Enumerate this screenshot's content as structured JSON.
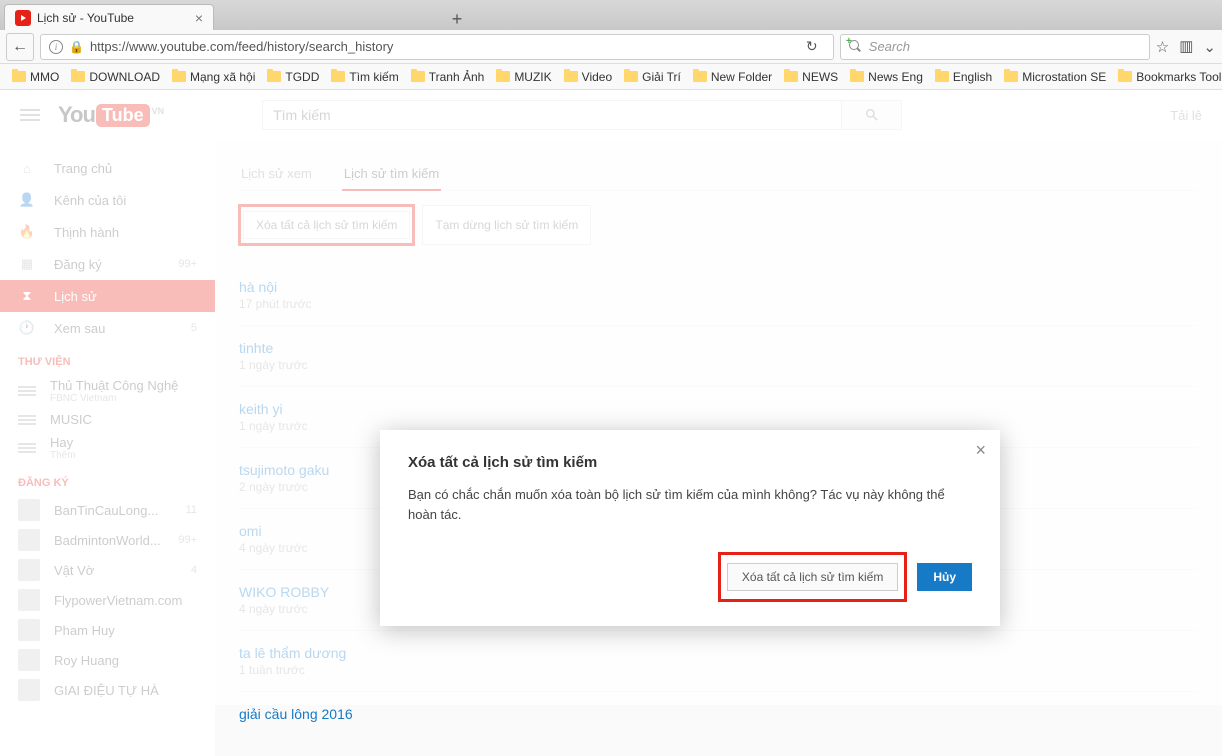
{
  "browser": {
    "tab_title": "Lịch sử - YouTube",
    "url": "https://www.youtube.com/feed/history/search_history",
    "search_placeholder": "Search"
  },
  "bookmarks": [
    "MMO",
    "DOWNLOAD",
    "Mạng xã hội",
    "TGDD",
    "Tìm kiếm",
    "Tranh Ảnh",
    "MUZIK",
    "Video",
    "Giải Trí",
    "New Folder",
    "NEWS",
    "News Eng",
    "English",
    "Microstation SE",
    "Bookmarks Toolbar"
  ],
  "logo": {
    "part1": "You",
    "part2": "Tube",
    "region": "VN"
  },
  "yt_search_placeholder": "Tìm kiếm",
  "upload_label": "Tải lê",
  "sidebar": {
    "items": [
      {
        "label": "Trang chủ"
      },
      {
        "label": "Kênh của tôi"
      },
      {
        "label": "Thịnh hành"
      },
      {
        "label": "Đăng ký",
        "badge": "99+"
      },
      {
        "label": "Lịch sử"
      },
      {
        "label": "Xem sau",
        "badge": "5"
      }
    ],
    "section_library": "THƯ VIỆN",
    "library": [
      {
        "label": "Thủ Thuật Công Nghệ",
        "meta": "FBNC Vietnam"
      },
      {
        "label": "MUSIC"
      },
      {
        "label": "Hay",
        "meta": "Thêm"
      }
    ],
    "section_subs": "ĐĂNG KÝ",
    "subs": [
      {
        "label": "BanTinCauLong...",
        "badge": "11"
      },
      {
        "label": "BadmintonWorld...",
        "badge": "99+"
      },
      {
        "label": "Vật Vờ",
        "badge": "4"
      },
      {
        "label": "FlypowerVietnam.com"
      },
      {
        "label": "Pham Huy"
      },
      {
        "label": "Roy Huang"
      },
      {
        "label": "GIAI ĐIỆU TỰ HÀ"
      }
    ]
  },
  "tabs": {
    "watch": "Lịch sử xem",
    "search": "Lịch sử tìm kiếm"
  },
  "actions": {
    "clear": "Xóa tất cả lịch sử tìm kiếm",
    "pause": "Tạm dừng lịch sử tìm kiếm"
  },
  "history": [
    {
      "q": "hà nội",
      "t": "17 phút trước"
    },
    {
      "q": "tinhte",
      "t": "1 ngày trước"
    },
    {
      "q": "keith yi",
      "t": "1 ngày trước"
    },
    {
      "q": "tsujimoto gaku",
      "t": "2 ngày trước"
    },
    {
      "q": "omi",
      "t": "4 ngày trước"
    },
    {
      "q": "WIKO ROBBY",
      "t": "4 ngày trước"
    },
    {
      "q": "ta lê thẩm dương",
      "t": "1 tuần trước"
    },
    {
      "q": "giải cầu lông 2016",
      "t": ""
    }
  ],
  "dialog": {
    "title": "Xóa tất cả lịch sử tìm kiếm",
    "body": "Bạn có chắc chắn muốn xóa toàn bộ lịch sử tìm kiếm của mình không? Tác vụ này không thể hoàn tác.",
    "confirm": "Xóa tất cả lịch sử tìm kiếm",
    "cancel": "Hủy"
  }
}
